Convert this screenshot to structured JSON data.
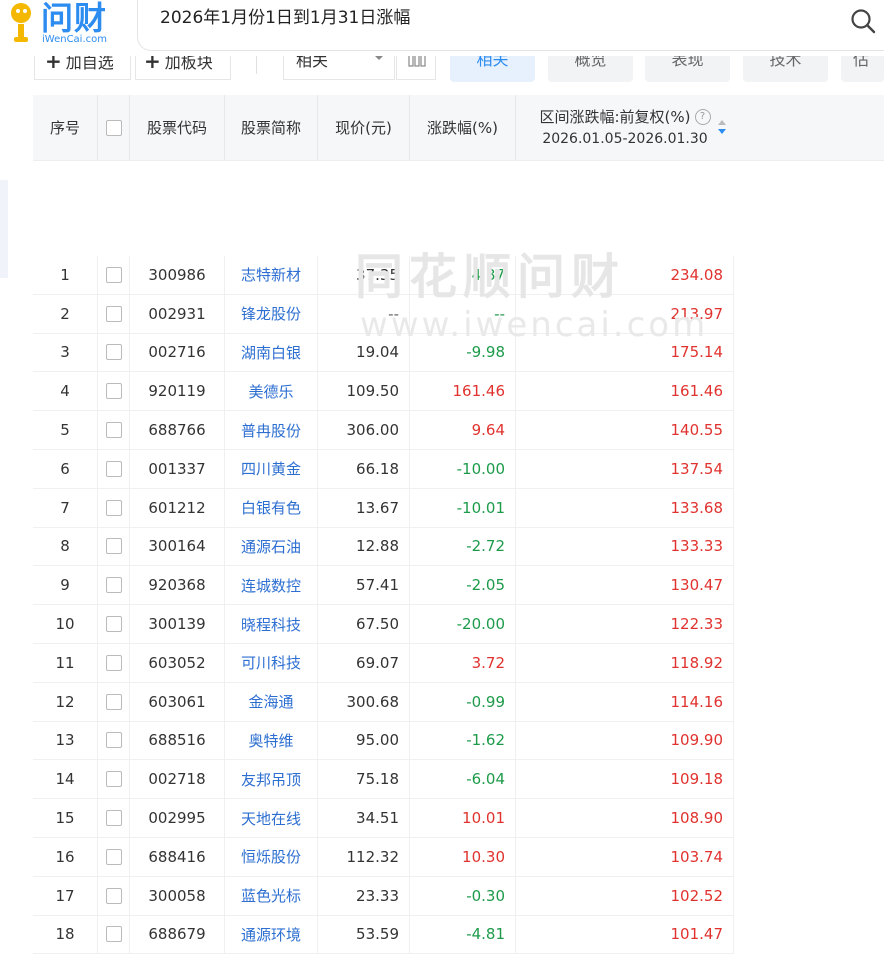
{
  "header": {
    "logo_text": "问财",
    "logo_sub": "iWenCai.com",
    "query": "2026年1月份1日到1月31日涨幅"
  },
  "toolbar": {
    "add_self_label": "加自选",
    "add_block_label": "加板块",
    "select_value": "相关",
    "tabs": [
      "相关",
      "概览",
      "表现",
      "技术",
      "估"
    ]
  },
  "table": {
    "headers": [
      "序号",
      "股票代码",
      "股票简称",
      "现价(元)",
      "涨跌幅(%)",
      "区间涨跌幅:前复权(%)"
    ],
    "range_sub": "2026.01.05-2026.01.30",
    "rows": [
      {
        "no": "1",
        "code": "300986",
        "name": "志特新材",
        "price": "37.35",
        "chg": "-4.87",
        "range": "234.08"
      },
      {
        "no": "2",
        "code": "002931",
        "name": "锋龙股份",
        "price": "--",
        "chg": "--",
        "range": "213.97"
      },
      {
        "no": "3",
        "code": "002716",
        "name": "湖南白银",
        "price": "19.04",
        "chg": "-9.98",
        "range": "175.14"
      },
      {
        "no": "4",
        "code": "920119",
        "name": "美德乐",
        "price": "109.50",
        "chg": "161.46",
        "range": "161.46"
      },
      {
        "no": "5",
        "code": "688766",
        "name": "普冉股份",
        "price": "306.00",
        "chg": "9.64",
        "range": "140.55"
      },
      {
        "no": "6",
        "code": "001337",
        "name": "四川黄金",
        "price": "66.18",
        "chg": "-10.00",
        "range": "137.54"
      },
      {
        "no": "7",
        "code": "601212",
        "name": "白银有色",
        "price": "13.67",
        "chg": "-10.01",
        "range": "133.68"
      },
      {
        "no": "8",
        "code": "300164",
        "name": "通源石油",
        "price": "12.88",
        "chg": "-2.72",
        "range": "133.33"
      },
      {
        "no": "9",
        "code": "920368",
        "name": "连城数控",
        "price": "57.41",
        "chg": "-2.05",
        "range": "130.47"
      },
      {
        "no": "10",
        "code": "300139",
        "name": "晓程科技",
        "price": "67.50",
        "chg": "-20.00",
        "range": "122.33"
      },
      {
        "no": "11",
        "code": "603052",
        "name": "可川科技",
        "price": "69.07",
        "chg": "3.72",
        "range": "118.92"
      },
      {
        "no": "12",
        "code": "603061",
        "name": "金海通",
        "price": "300.68",
        "chg": "-0.99",
        "range": "114.16"
      },
      {
        "no": "13",
        "code": "688516",
        "name": "奥特维",
        "price": "95.00",
        "chg": "-1.62",
        "range": "109.90"
      },
      {
        "no": "14",
        "code": "002718",
        "name": "友邦吊顶",
        "price": "75.18",
        "chg": "-6.04",
        "range": "109.18"
      },
      {
        "no": "15",
        "code": "002995",
        "name": "天地在线",
        "price": "34.51",
        "chg": "10.01",
        "range": "108.90"
      },
      {
        "no": "16",
        "code": "688416",
        "name": "恒烁股份",
        "price": "112.32",
        "chg": "10.30",
        "range": "103.74"
      },
      {
        "no": "17",
        "code": "300058",
        "name": "蓝色光标",
        "price": "23.33",
        "chg": "-0.30",
        "range": "102.52"
      },
      {
        "no": "18",
        "code": "688679",
        "name": "通源环境",
        "price": "53.59",
        "chg": "-4.81",
        "range": "101.47"
      }
    ]
  },
  "watermark": {
    "line1": "同花顺问财",
    "line2": "www.iwencai.com"
  },
  "colors": {
    "up": "#e0322e",
    "down": "#1d9b4a",
    "brand": "#2d8cf0",
    "link": "#2d6fd1"
  }
}
